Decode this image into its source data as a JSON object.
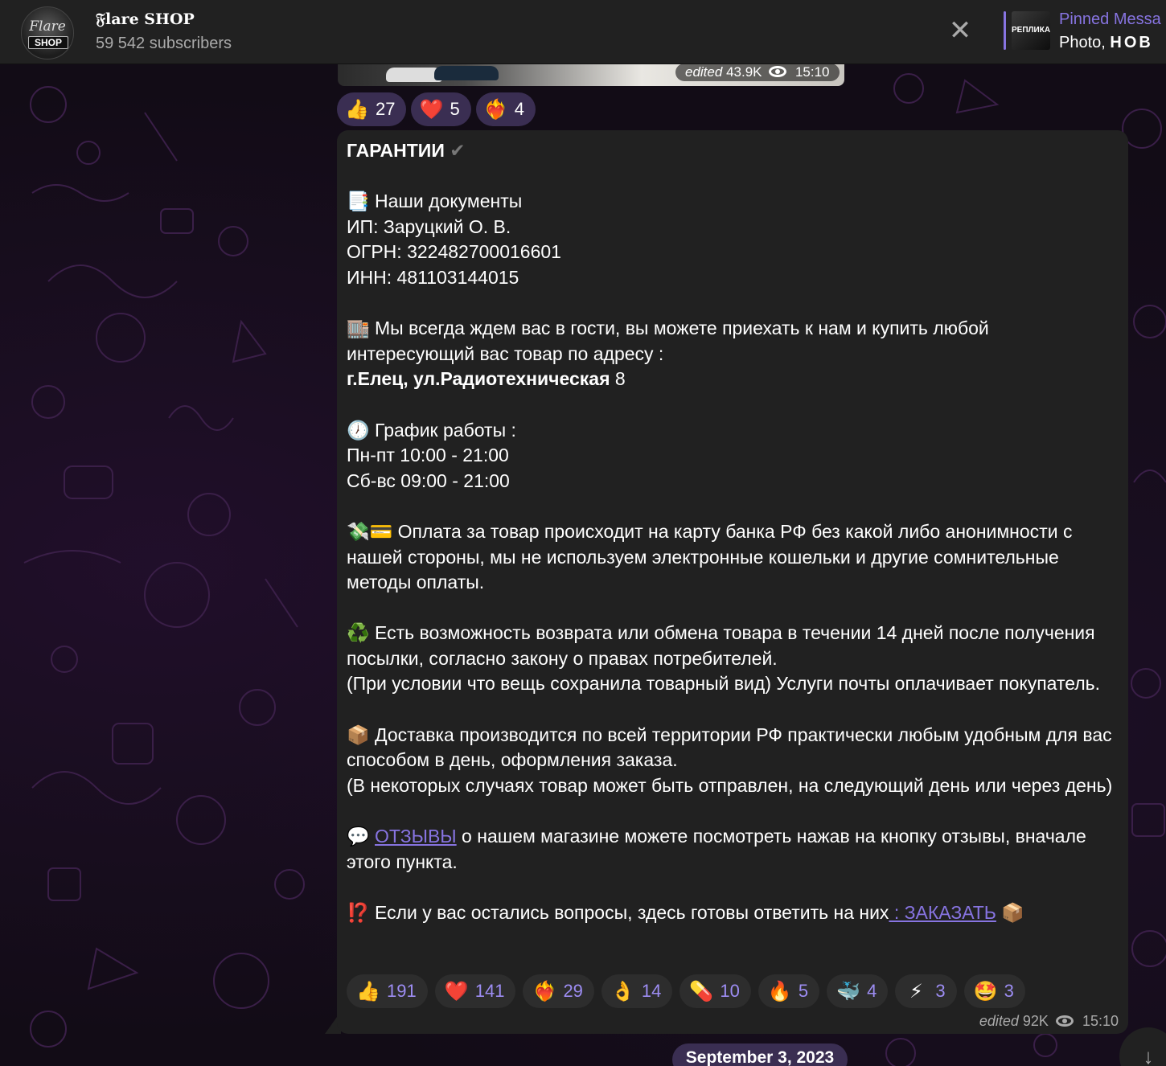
{
  "header": {
    "channel_title": "𝔉lare SHOP",
    "subscribers": "59 542 subscribers",
    "avatar": {
      "logo_top": "Flare",
      "logo_bottom": "SHOP"
    },
    "close_icon": "close-icon",
    "pinned": {
      "title": "Pinned Messa",
      "text_prefix": "Photo, ",
      "text_bold": "НОВ",
      "thumb_label": "РЕПЛИКА"
    }
  },
  "previous_message": {
    "edited": "edited",
    "views": "43.9K",
    "time": "15:10",
    "reactions": [
      {
        "emoji": "👍",
        "count": "27"
      },
      {
        "emoji": "❤️",
        "count": "5"
      },
      {
        "emoji": "❤️‍🔥",
        "count": "4"
      }
    ]
  },
  "message": {
    "title": "ГАРАНТИИ",
    "title_mark": "✔",
    "docs_heading": "📑 Наши документы",
    "ip": "ИП: Заруцкий О. В.",
    "ogrn": "ОГРН: 322482700016601",
    "inn": "ИНН: 481103144015",
    "visit_text": "🏬 Мы всегда ждем вас в гости, вы можете приехать к нам и купить любой интересующий вас товар по адресу :",
    "address_bold": "г.Елец, ул.Радиотехническая",
    "address_num": " 8",
    "schedule_heading": "🕖 График работы :",
    "weekdays": "Пн-пт 10:00 - 21:00",
    "weekend": "Сб-вс 09:00 - 21:00",
    "payment": "💸💳 Оплата за товар происходит на карту банка РФ без какой либо анонимности с нашей стороны, мы не используем электронные кошельки и другие сомнительные методы оплаты.",
    "return_1": "♻️ Есть возможность возврата или обмена товара в течении 14 дней после получения посылки, согласно закону о правах потребителей.",
    "return_2": "(При условии что вещь сохранила товарный вид) Услуги почты оплачивает покупатель.",
    "delivery_1": "📦 Доставка производится по всей территории РФ практически любым удобным для вас способом в день, оформления заказа.",
    "delivery_2": "(В некоторых случаях товар может быть отправлен, на следующий день или через день)",
    "reviews_prefix": "💬 ",
    "reviews_link": "ОТЗЫВЫ",
    "reviews_rest": " о нашем магазине можете посмотреть нажав на кнопку отзывы, вначале этого пункта.",
    "questions_prefix": "⁉️ Если у вас остались вопросы, здесь готовы ответить на них",
    "order_link": " : ЗАКАЗАТЬ",
    "questions_suffix": " 📦",
    "reactions": [
      {
        "emoji": "👍",
        "count": "191"
      },
      {
        "emoji": "❤️",
        "count": "141"
      },
      {
        "emoji": "❤️‍🔥",
        "count": "29"
      },
      {
        "emoji": "👌",
        "count": "14"
      },
      {
        "emoji": "💊",
        "count": "10"
      },
      {
        "emoji": "🔥",
        "count": "5"
      },
      {
        "emoji": "🐳",
        "count": "4"
      },
      {
        "emoji": "⚡",
        "count": "3"
      },
      {
        "emoji": "🤩",
        "count": "3"
      }
    ],
    "edited": "edited",
    "views": "92K",
    "time": "15:10"
  },
  "date_separator": "September 3, 2023",
  "scroll_icon": "arrow-down-icon",
  "colors": {
    "accent": "#8774e1",
    "bubble": "#212121",
    "reaction_bg": "#3a2e52"
  }
}
